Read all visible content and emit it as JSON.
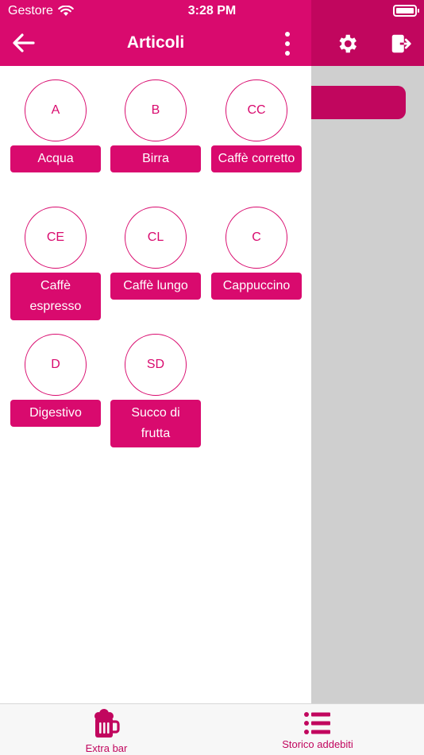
{
  "status_bar": {
    "carrier": "Gestore",
    "time": "3:28 PM"
  },
  "drawer": {
    "title": "Articoli",
    "articles": [
      {
        "code": "A",
        "name": "Acqua"
      },
      {
        "code": "B",
        "name": "Birra"
      },
      {
        "code": "CC",
        "name": "Caffè corretto"
      },
      {
        "code": "CE",
        "name": "Caffè espresso"
      },
      {
        "code": "CL",
        "name": "Caffè lungo"
      },
      {
        "code": "C",
        "name": "Cappuccino"
      },
      {
        "code": "D",
        "name": "Digestivo"
      },
      {
        "code": "SD",
        "name": "Succo di frutta"
      }
    ]
  },
  "tabbar": {
    "tabs": [
      {
        "label": "Extra bar",
        "icon": "beer-mug-icon"
      },
      {
        "label": "Storico addebiti",
        "icon": "list-icon"
      }
    ]
  },
  "colors": {
    "primary": "#d90a6e",
    "primary_dark": "#c1065e",
    "overlay_gray": "#cfcfcf"
  }
}
